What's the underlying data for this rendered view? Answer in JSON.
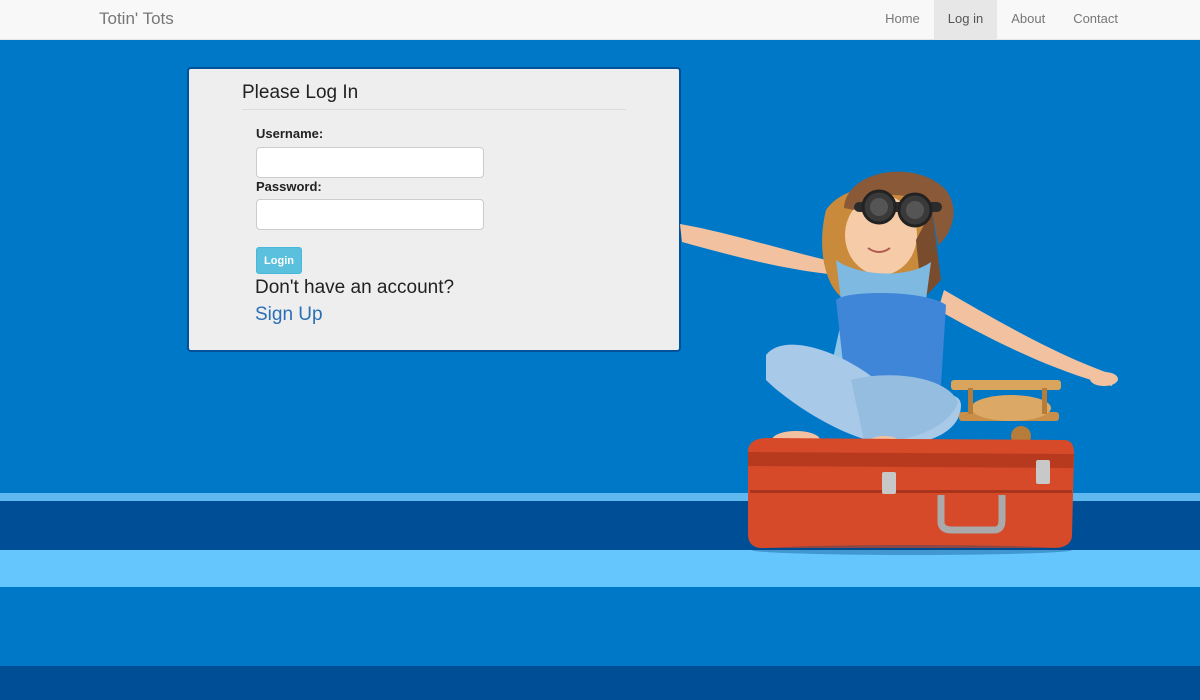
{
  "navbar": {
    "brand": "Totin' Tots",
    "items": [
      {
        "label": "Home"
      },
      {
        "label": "Log in",
        "active": true
      },
      {
        "label": "About"
      },
      {
        "label": "Contact"
      }
    ]
  },
  "login": {
    "title": "Please Log In",
    "username_label": "Username:",
    "username_value": "",
    "password_label": "Password:",
    "password_value": "",
    "login_button": "Login",
    "no_account_text": "Don't have an account?",
    "signup_link": "Sign Up"
  },
  "colors": {
    "background": "#0078c8",
    "panel_border": "#02519a",
    "button": "#5bc0de",
    "link": "#2a6fb5"
  },
  "hero_image": {
    "icon": "child-aviator-on-suitcase-illustration"
  }
}
